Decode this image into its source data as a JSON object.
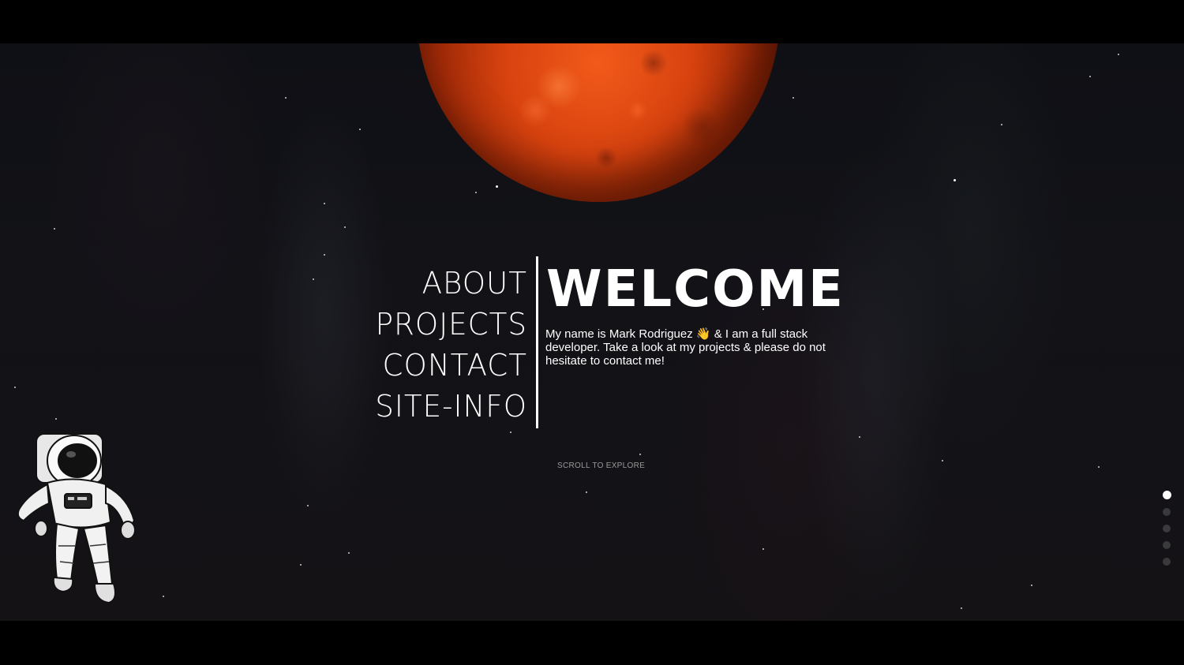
{
  "nav": {
    "items": [
      {
        "label": "ABOUT"
      },
      {
        "label": "PROJECTS"
      },
      {
        "label": "CONTACT"
      },
      {
        "label": "SITE-INFO"
      }
    ]
  },
  "hero": {
    "title": "WELCOME",
    "intro": "My name is Mark Rodriguez 👋 & I am a full stack developer. Take a look at my projects & please do not hesitate to contact me!"
  },
  "scroll_hint": "SCROLL TO EXPLORE",
  "section_dots": {
    "count": 5,
    "active_index": 0
  },
  "colors": {
    "planet": "#d8430f",
    "background": "#121217",
    "text": "#ffffff",
    "dot_inactive": "#3a3a3d"
  },
  "icons": {
    "planet": "mars-planet",
    "astronaut": "astronaut-illustration"
  }
}
